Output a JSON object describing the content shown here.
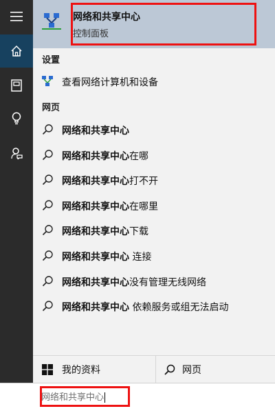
{
  "best_match": {
    "title": "网络和共享中心",
    "subtitle": "控制面板"
  },
  "sections": {
    "settings": "设置",
    "web": "网页"
  },
  "settings_items": [
    {
      "label": "查看网络计算机和设备",
      "icon": "network-devices-icon"
    }
  ],
  "web_items": [
    {
      "bold": "网络和共享中心",
      "rest": ""
    },
    {
      "bold": "网络和共享中心",
      "rest": "在哪"
    },
    {
      "bold": "网络和共享中心",
      "rest": "打不开"
    },
    {
      "bold": "网络和共享中心",
      "rest": "在哪里"
    },
    {
      "bold": "网络和共享中心",
      "rest": "下载"
    },
    {
      "bold": "网络和共享中心",
      "rest": " 连接"
    },
    {
      "bold": "网络和共享中心",
      "rest": "没有管理无线网络"
    },
    {
      "bold": "网络和共享中心",
      "rest": " 依赖服务或组无法启动"
    }
  ],
  "bottom_tabs": {
    "my_stuff": "我的资料",
    "web": "网页"
  },
  "search": {
    "value": "网络和共享中心"
  },
  "rail_icons": [
    "hamburger-menu-icon",
    "home-icon",
    "notebook-icon",
    "lightbulb-icon",
    "feedback-icon"
  ],
  "colors": {
    "rail": "#2b2b2b",
    "rail_active": "#17415f",
    "best_match_bg": "#bcc8d6",
    "highlight": "#e11111"
  }
}
